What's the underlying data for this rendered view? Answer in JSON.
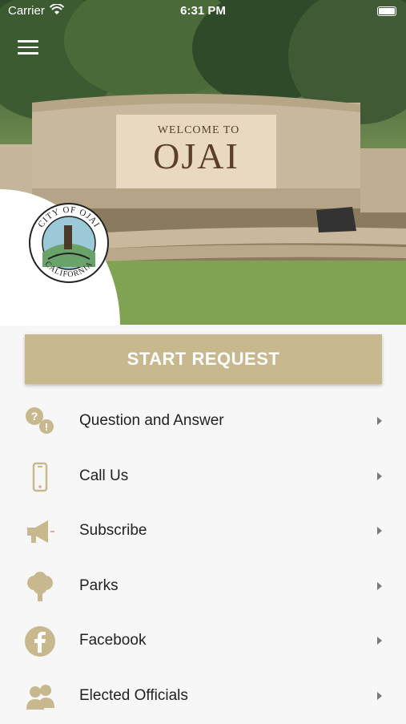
{
  "status_bar": {
    "carrier": "Carrier",
    "time": "6:31 PM"
  },
  "hero": {
    "sign_line1": "WELCOME TO",
    "sign_line2": "OJAI"
  },
  "seal": {
    "top_text": "CITY OF OJAI",
    "bottom_text": "CALIFORNIA"
  },
  "start_button": {
    "label": "START REQUEST"
  },
  "menu_items": [
    {
      "label": "Question and Answer",
      "icon": "question-answer-icon"
    },
    {
      "label": "Call Us",
      "icon": "phone-icon"
    },
    {
      "label": "Subscribe",
      "icon": "megaphone-icon"
    },
    {
      "label": "Parks",
      "icon": "tree-icon"
    },
    {
      "label": "Facebook",
      "icon": "facebook-icon"
    },
    {
      "label": "Elected Officials",
      "icon": "officials-icon"
    }
  ],
  "colors": {
    "accent": "#c8b88e",
    "icon": "#c8b88e",
    "text": "#222222"
  }
}
